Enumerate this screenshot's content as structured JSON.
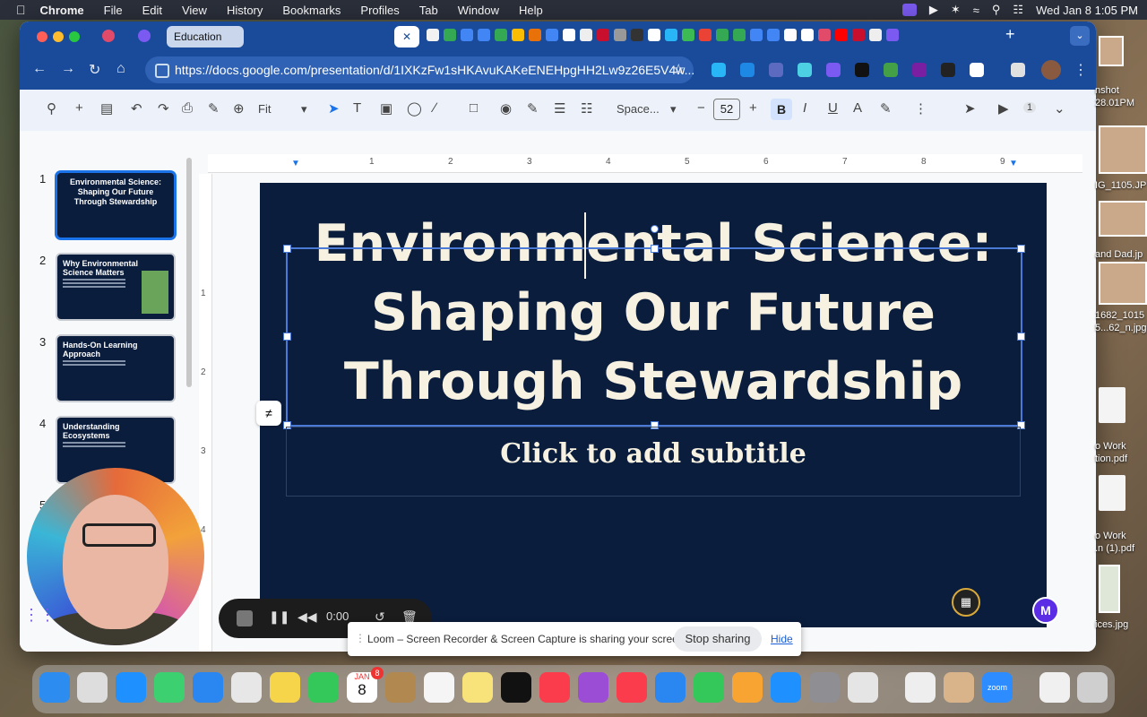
{
  "menubar": {
    "app": "Chrome",
    "items": [
      "File",
      "Edit",
      "View",
      "History",
      "Bookmarks",
      "Profiles",
      "Tab",
      "Window",
      "Help"
    ],
    "clock": "Wed Jan 8  1:05 PM"
  },
  "browser": {
    "tab_group_label": "Education",
    "url": "https://docs.google.com/presentation/d/1IXKzFw1sHKAvuKAKeENEHpgHH2Lw9z26E5V4w..."
  },
  "toolbar": {
    "zoom": "Fit",
    "font": "Space...",
    "font_size": "52",
    "bold_label": "B",
    "italic_label": "I",
    "underline_label": "U",
    "text_color_label": "A",
    "badge_count": "1"
  },
  "ruler": {
    "h_ticks": [
      "1",
      "2",
      "3",
      "4",
      "5",
      "6",
      "7",
      "8",
      "9"
    ],
    "v_ticks": [
      "1",
      "2",
      "3",
      "4"
    ]
  },
  "slides": [
    {
      "number": "1",
      "title": "Environmental Science: Shaping Our Future Through Stewardship"
    },
    {
      "number": "2",
      "title": "Why Environmental Science Matters"
    },
    {
      "number": "3",
      "title": "Hands-On Learning Approach"
    },
    {
      "number": "4",
      "title": "Understanding Ecosystems"
    },
    {
      "number": "5",
      "title": ""
    }
  ],
  "canvas": {
    "title_line1": "Environmental Science:",
    "title_line2": "Shaping Our Future",
    "title_line3": "Through Stewardship",
    "subtitle_placeholder": "Click to add subtitle"
  },
  "loom": {
    "timer": "0:00",
    "share_message": "Loom – Screen Recorder & Screen Capture is sharing your screen.",
    "stop_label": "Stop sharing",
    "hide_label": "Hide"
  },
  "desktop_files": [
    "nshot",
    "28.01PM",
    "IG_1105.JP",
    "and Dad.jp",
    "1682_1015",
    "5...62_n.jpg",
    "o Work",
    "tion.pdf",
    "o Work",
    ".n (1).pdf",
    "ices.jpg"
  ],
  "dock": {
    "calendar_month": "JAN",
    "calendar_day": "8",
    "calendar_badge": "8",
    "zoom_label": "zoom"
  }
}
